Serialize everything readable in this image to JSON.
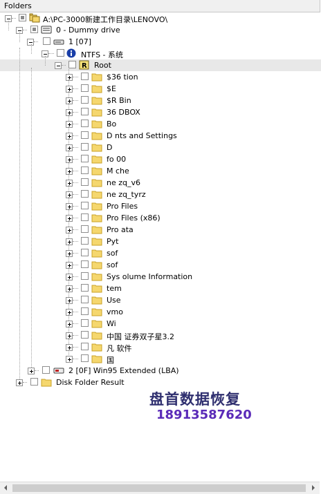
{
  "header": {
    "title": "Folders"
  },
  "tree": {
    "root": "A:\\PC-3000新建工作目录\\LENOVO\\",
    "drive": "0 - Dummy drive",
    "partition": "1 [07]",
    "fs": "NTFS - 系统",
    "root_folder": "Root",
    "folders": [
      "$36          tion",
      "$E",
      "$R            Bin",
      "36          DBOX",
      "Bo",
      "D          nts and Settings",
      "D",
      "fo          00",
      "M          che",
      "ne          zq_v6",
      "ne          zq_tyrz",
      "Pro          Files",
      "Pro          Files (x86)",
      "Pro          ata",
      "Pyt",
      "sof",
      "sof",
      "Sys          olume Information",
      "tem",
      "Use",
      "vmo",
      "Wi",
      "中国          证券双子星3.2",
      "凡          软件",
      "国"
    ],
    "extended": "2 [0F] Win95 Extended  (LBA)",
    "disk_result": "Disk Folder Result"
  },
  "watermark": {
    "line1": "盘首数据恢复",
    "line2": "18913587620"
  },
  "colors": {
    "folder": "#f5d76e",
    "folder_edge": "#c9a227",
    "selected": "#e8e8e8",
    "watermark1": "#2f2f6f",
    "watermark2": "#5a2ab8"
  }
}
